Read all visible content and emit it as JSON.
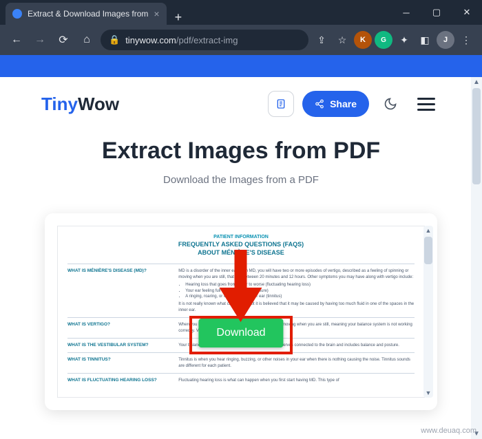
{
  "browser": {
    "tab_title": "Extract & Download Images from",
    "url_host": "tinywow.com",
    "url_path": "/pdf/extract-img",
    "extensions": {
      "k": "K",
      "g": "G"
    },
    "avatar": "J"
  },
  "header": {
    "logo_tiny": "Tiny",
    "logo_wow": "Wow",
    "share_label": "Share"
  },
  "main": {
    "title": "Extract Images from PDF",
    "subtitle": "Download the Images from a PDF",
    "download_label": "Download"
  },
  "doc": {
    "header": "PATIENT INFORMATION",
    "title_line1": "FREQUENTLY ASKED QUESTIONS (FAQS)",
    "title_line2": "ABOUT MÉNIÈRE'S DISEASE",
    "rows": [
      {
        "label": "WHAT IS MÉNIÈRE'S DISEASE (MD)?",
        "text": "MD is a disorder of the inner ear. With MD, you will have two or more episodes of vertigo, described as a feeling of spinning or moving when you are still, that last between 20 minutes and 12 hours. Other symptoms you may have along with vertigo include:",
        "bullets": [
          "Hearing loss that goes from better to worse (fluctuating hearing loss)",
          "Your ear feeling full or plugged (ear pressure)",
          "A ringing, roaring, or other noise in your ear (tinnitus)"
        ],
        "after": "It is not really known what causes MD but it is believed that it may be caused by having too much fluid in one of the spaces in the inner ear."
      },
      {
        "label": "WHAT IS VERTIGO?",
        "text": "When you have vertigo, you feel like you are spinning or moving when you are still, meaning your balance system is not working correctly. Vertigo can also be nothing causing the noise."
      },
      {
        "label": "WHAT IS THE VESTIBULAR SYSTEM?",
        "text": "Your balance system includes your inner ear, eyes, and nerves connected to the brain and includes balance and posture."
      },
      {
        "label": "WHAT IS TINNITUS?",
        "text": "Tinnitus is when you hear ringing, buzzing, or other noises in your ear when there is nothing causing the noise. Tinnitus sounds are different for each patient."
      },
      {
        "label": "WHAT IS FLUCTUATING HEARING LOSS?",
        "text": "Fluctuating hearing loss is what can happen when you first start having MD. This type of"
      }
    ]
  },
  "watermark": "www.deuaq.com"
}
